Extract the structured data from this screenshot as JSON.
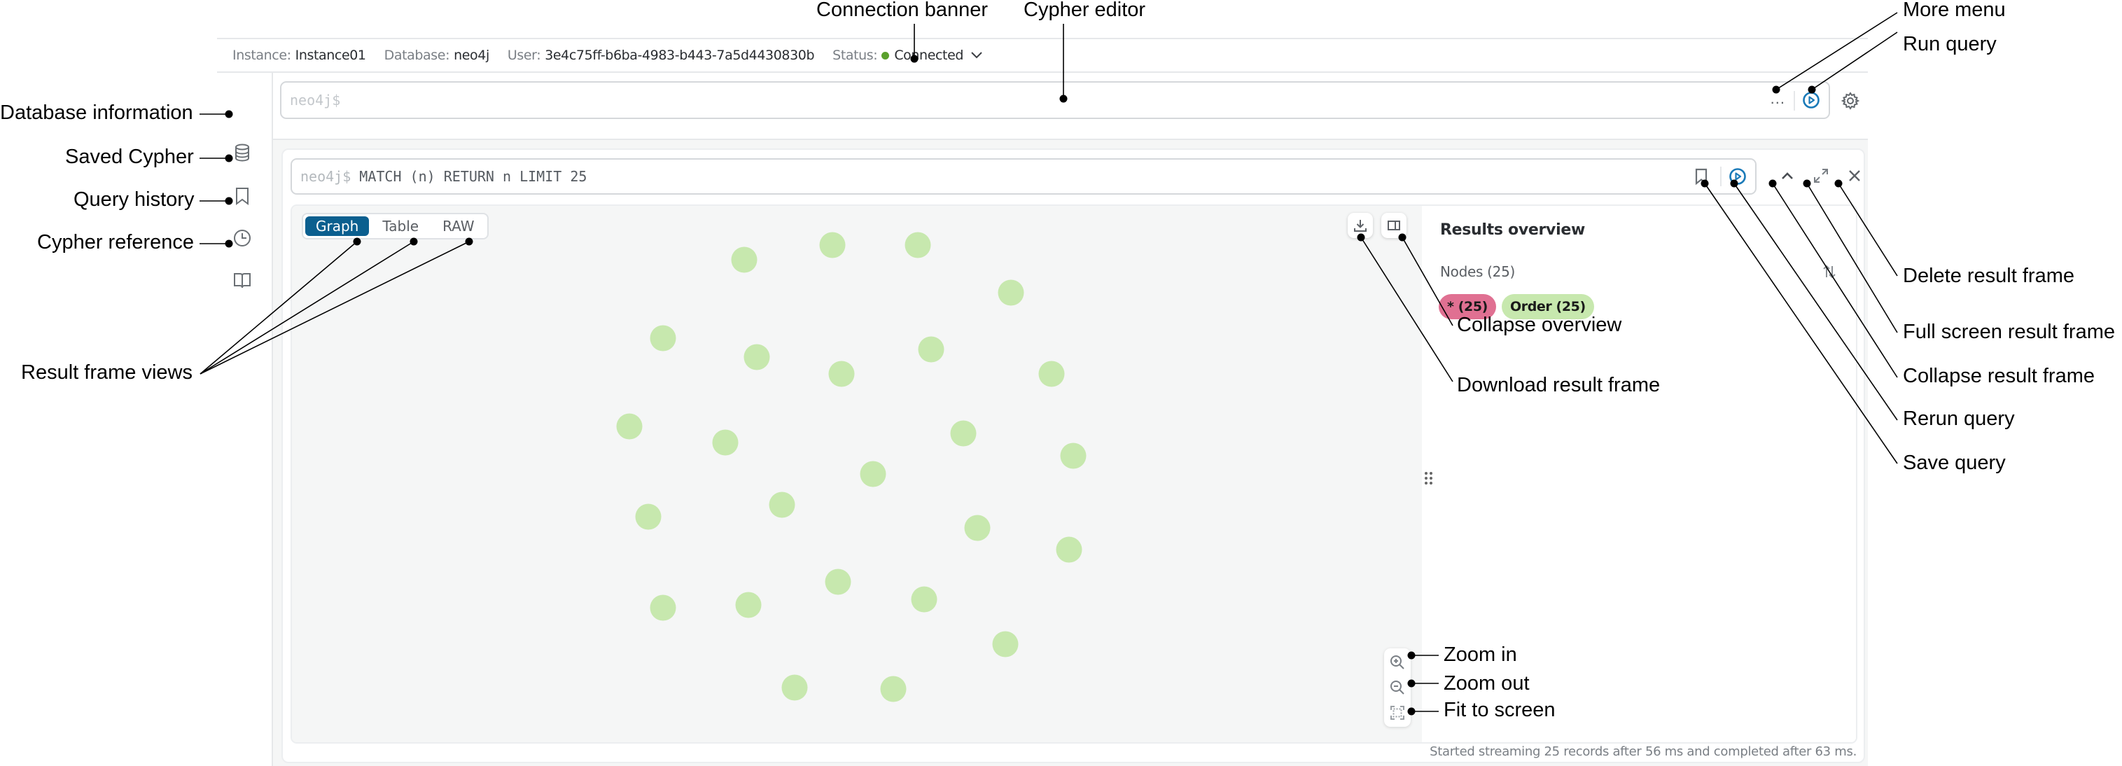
{
  "banner": {
    "instance_label": "Instance:",
    "instance_value": "Instance01",
    "database_label": "Database:",
    "database_value": "neo4j",
    "user_label": "User:",
    "user_value": "3e4c75ff-b6ba-4983-b443-7a5d4430830b",
    "status_label": "Status:",
    "status_value": "Connected",
    "status_color": "#5aa02c"
  },
  "sidebar": {
    "items": [
      {
        "icon": "database-icon",
        "label": "Database information"
      },
      {
        "icon": "bookmark-icon",
        "label": "Saved Cypher"
      },
      {
        "icon": "clock-icon",
        "label": "Query history"
      },
      {
        "icon": "book-icon",
        "label": "Cypher reference"
      }
    ]
  },
  "editor": {
    "prompt": "neo4j$",
    "value": "",
    "more_label": "...",
    "run_icon": "play-circle-icon",
    "settings_icon": "gear-icon"
  },
  "frame": {
    "prompt": "neo4j$",
    "query": "MATCH (n) RETURN n LIMIT 25",
    "views": [
      "Graph",
      "Table",
      "RAW"
    ],
    "active_view": "Graph",
    "overview": {
      "title": "Results overview",
      "nodes_label": "Nodes (25)",
      "labels": [
        {
          "text": "* (25)",
          "color": "#e07092"
        },
        {
          "text": "Order (25)",
          "color": "#c7e8ae"
        }
      ]
    },
    "graph": {
      "node_color": "#c7e8ae",
      "node_count": 25
    },
    "status_text": "Started streaming 25 records after 56 ms and completed after 63 ms."
  },
  "annotations": {
    "connection_banner": "Connection banner",
    "cypher_editor": "Cypher editor",
    "more_menu": "More menu",
    "run_query": "Run query",
    "database_information": "Database information",
    "saved_cypher": "Saved Cypher",
    "query_history": "Query history",
    "cypher_reference": "Cypher reference",
    "result_frame_views": "Result frame views",
    "collapse_overview": "Collapse overview",
    "download_result_frame": "Download result frame",
    "delete_result_frame": "Delete result frame",
    "full_screen_result_frame": "Full screen result frame",
    "collapse_result_frame": "Collapse result frame",
    "rerun_query": "Rerun query",
    "save_query": "Save query",
    "zoom_in": "Zoom in",
    "zoom_out": "Zoom out",
    "fit_to_screen": "Fit to screen"
  },
  "accent_color": "#0b5f8f"
}
